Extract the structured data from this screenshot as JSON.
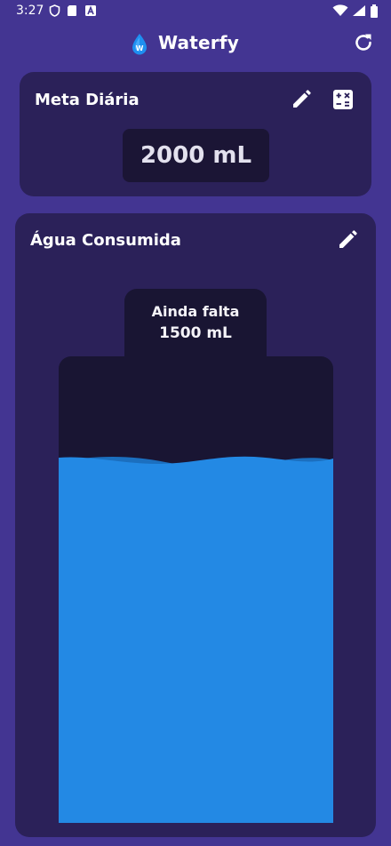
{
  "status_bar": {
    "time": "3:27",
    "icons": [
      "shield-icon",
      "sd-card-icon",
      "a-badge-icon",
      "wifi-icon",
      "signal-icon",
      "battery-icon"
    ]
  },
  "app": {
    "title": "Waterfy",
    "logo": "water-drop-logo",
    "refresh_icon": "refresh-icon"
  },
  "daily_goal": {
    "title": "Meta Diária",
    "value": "2000 mL",
    "edit_icon": "pencil-icon",
    "calculator_icon": "calculator-icon"
  },
  "water_consumed": {
    "title": "Água Consumida",
    "edit_icon": "pencil-icon",
    "remaining_label": "Ainda falta",
    "remaining_value": "1500 mL",
    "fill_fraction": 0.77
  },
  "colors": {
    "background": "#433592",
    "card": "#2b2159",
    "bottle": "#191533",
    "water": "#2389e4",
    "water_dark": "#1b6fbf"
  }
}
